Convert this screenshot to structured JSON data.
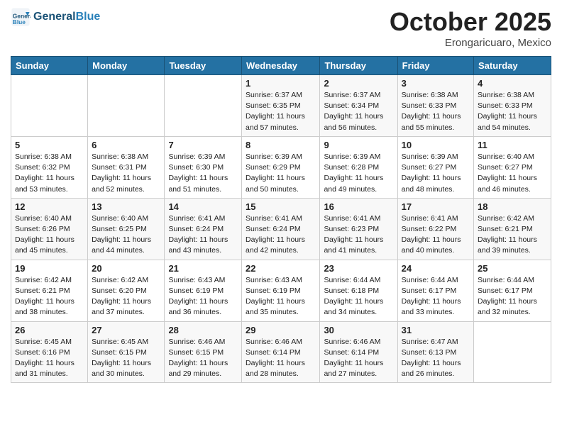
{
  "header": {
    "logo_line1": "General",
    "logo_line2": "Blue",
    "month_title": "October 2025",
    "location": "Erongaricuaro, Mexico"
  },
  "days_of_week": [
    "Sunday",
    "Monday",
    "Tuesday",
    "Wednesday",
    "Thursday",
    "Friday",
    "Saturday"
  ],
  "weeks": [
    [
      {
        "day": "",
        "info": ""
      },
      {
        "day": "",
        "info": ""
      },
      {
        "day": "",
        "info": ""
      },
      {
        "day": "1",
        "info": "Sunrise: 6:37 AM\nSunset: 6:35 PM\nDaylight: 11 hours and 57 minutes."
      },
      {
        "day": "2",
        "info": "Sunrise: 6:37 AM\nSunset: 6:34 PM\nDaylight: 11 hours and 56 minutes."
      },
      {
        "day": "3",
        "info": "Sunrise: 6:38 AM\nSunset: 6:33 PM\nDaylight: 11 hours and 55 minutes."
      },
      {
        "day": "4",
        "info": "Sunrise: 6:38 AM\nSunset: 6:33 PM\nDaylight: 11 hours and 54 minutes."
      }
    ],
    [
      {
        "day": "5",
        "info": "Sunrise: 6:38 AM\nSunset: 6:32 PM\nDaylight: 11 hours and 53 minutes."
      },
      {
        "day": "6",
        "info": "Sunrise: 6:38 AM\nSunset: 6:31 PM\nDaylight: 11 hours and 52 minutes."
      },
      {
        "day": "7",
        "info": "Sunrise: 6:39 AM\nSunset: 6:30 PM\nDaylight: 11 hours and 51 minutes."
      },
      {
        "day": "8",
        "info": "Sunrise: 6:39 AM\nSunset: 6:29 PM\nDaylight: 11 hours and 50 minutes."
      },
      {
        "day": "9",
        "info": "Sunrise: 6:39 AM\nSunset: 6:28 PM\nDaylight: 11 hours and 49 minutes."
      },
      {
        "day": "10",
        "info": "Sunrise: 6:39 AM\nSunset: 6:27 PM\nDaylight: 11 hours and 48 minutes."
      },
      {
        "day": "11",
        "info": "Sunrise: 6:40 AM\nSunset: 6:27 PM\nDaylight: 11 hours and 46 minutes."
      }
    ],
    [
      {
        "day": "12",
        "info": "Sunrise: 6:40 AM\nSunset: 6:26 PM\nDaylight: 11 hours and 45 minutes."
      },
      {
        "day": "13",
        "info": "Sunrise: 6:40 AM\nSunset: 6:25 PM\nDaylight: 11 hours and 44 minutes."
      },
      {
        "day": "14",
        "info": "Sunrise: 6:41 AM\nSunset: 6:24 PM\nDaylight: 11 hours and 43 minutes."
      },
      {
        "day": "15",
        "info": "Sunrise: 6:41 AM\nSunset: 6:24 PM\nDaylight: 11 hours and 42 minutes."
      },
      {
        "day": "16",
        "info": "Sunrise: 6:41 AM\nSunset: 6:23 PM\nDaylight: 11 hours and 41 minutes."
      },
      {
        "day": "17",
        "info": "Sunrise: 6:41 AM\nSunset: 6:22 PM\nDaylight: 11 hours and 40 minutes."
      },
      {
        "day": "18",
        "info": "Sunrise: 6:42 AM\nSunset: 6:21 PM\nDaylight: 11 hours and 39 minutes."
      }
    ],
    [
      {
        "day": "19",
        "info": "Sunrise: 6:42 AM\nSunset: 6:21 PM\nDaylight: 11 hours and 38 minutes."
      },
      {
        "day": "20",
        "info": "Sunrise: 6:42 AM\nSunset: 6:20 PM\nDaylight: 11 hours and 37 minutes."
      },
      {
        "day": "21",
        "info": "Sunrise: 6:43 AM\nSunset: 6:19 PM\nDaylight: 11 hours and 36 minutes."
      },
      {
        "day": "22",
        "info": "Sunrise: 6:43 AM\nSunset: 6:19 PM\nDaylight: 11 hours and 35 minutes."
      },
      {
        "day": "23",
        "info": "Sunrise: 6:44 AM\nSunset: 6:18 PM\nDaylight: 11 hours and 34 minutes."
      },
      {
        "day": "24",
        "info": "Sunrise: 6:44 AM\nSunset: 6:17 PM\nDaylight: 11 hours and 33 minutes."
      },
      {
        "day": "25",
        "info": "Sunrise: 6:44 AM\nSunset: 6:17 PM\nDaylight: 11 hours and 32 minutes."
      }
    ],
    [
      {
        "day": "26",
        "info": "Sunrise: 6:45 AM\nSunset: 6:16 PM\nDaylight: 11 hours and 31 minutes."
      },
      {
        "day": "27",
        "info": "Sunrise: 6:45 AM\nSunset: 6:15 PM\nDaylight: 11 hours and 30 minutes."
      },
      {
        "day": "28",
        "info": "Sunrise: 6:46 AM\nSunset: 6:15 PM\nDaylight: 11 hours and 29 minutes."
      },
      {
        "day": "29",
        "info": "Sunrise: 6:46 AM\nSunset: 6:14 PM\nDaylight: 11 hours and 28 minutes."
      },
      {
        "day": "30",
        "info": "Sunrise: 6:46 AM\nSunset: 6:14 PM\nDaylight: 11 hours and 27 minutes."
      },
      {
        "day": "31",
        "info": "Sunrise: 6:47 AM\nSunset: 6:13 PM\nDaylight: 11 hours and 26 minutes."
      },
      {
        "day": "",
        "info": ""
      }
    ]
  ]
}
